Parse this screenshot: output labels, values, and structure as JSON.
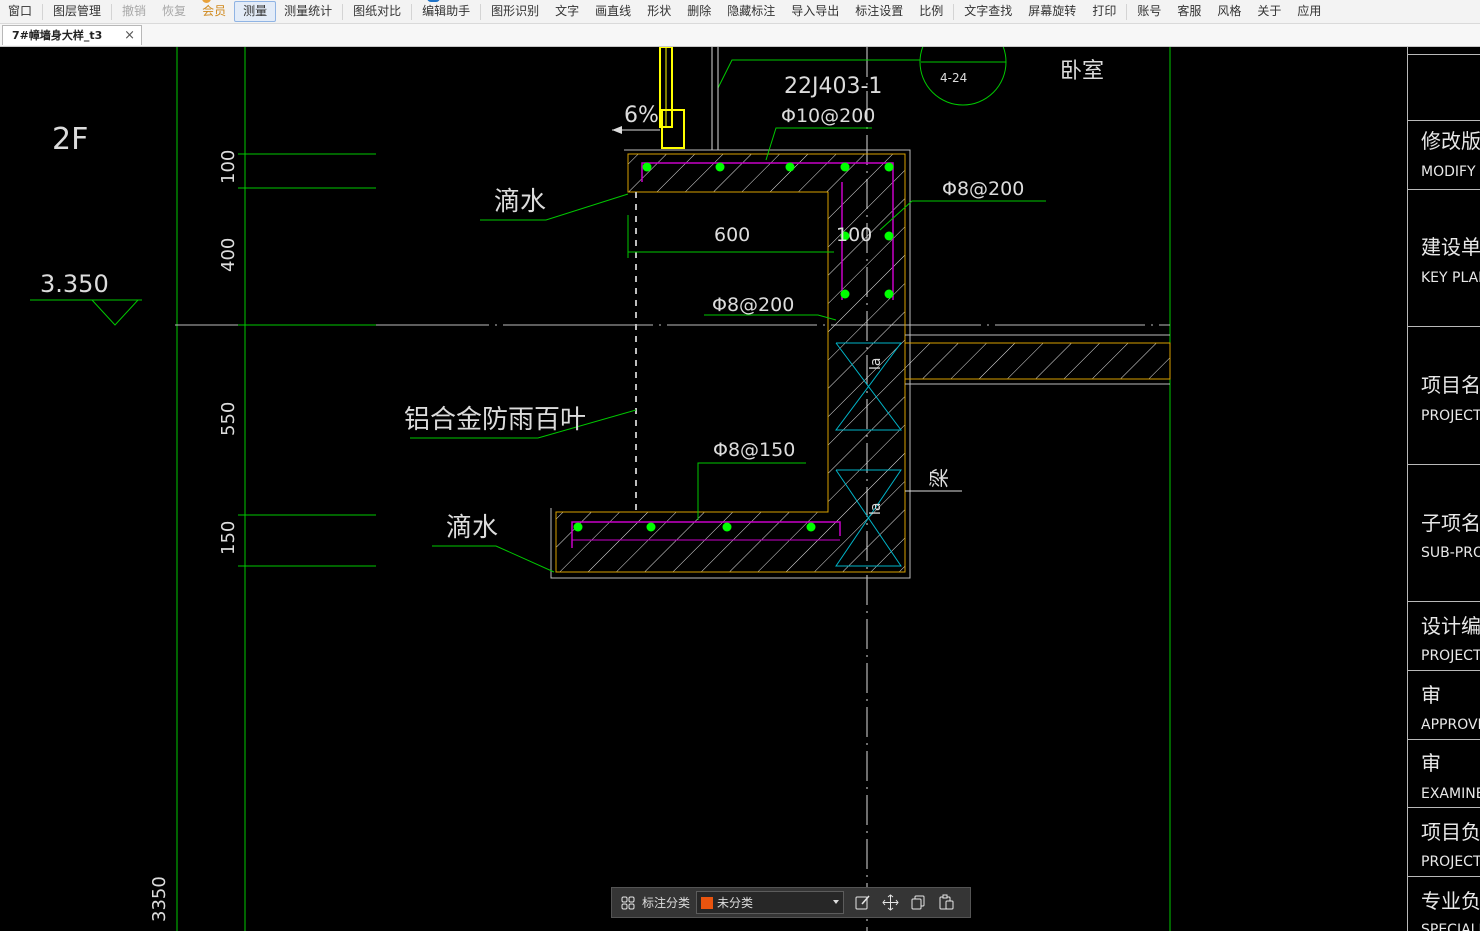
{
  "menu": {
    "items": [
      "窗口",
      "图层管理",
      "撤销",
      "恢复",
      "会员",
      "测量",
      "测量统计",
      "图纸对比",
      "编辑助手",
      "图形识别",
      "文字",
      "画直线",
      "形状",
      "删除",
      "隐藏标注",
      "导入导出",
      "标注设置",
      "比例",
      "文字查找",
      "屏幕旋转",
      "打印",
      "账号",
      "客服",
      "风格",
      "关于",
      "应用"
    ],
    "active": "测量",
    "disabled": [
      "撤销",
      "恢复"
    ]
  },
  "tab": {
    "title": "7#幛墙身大样_t3",
    "close": "×"
  },
  "drawing": {
    "floor": "2F",
    "elevation": "3.350",
    "dims": [
      "100",
      "400",
      "550",
      "150",
      "3350"
    ],
    "detail_ref": "22J403-1",
    "circle_ref": "4-24",
    "bedroom": "卧室",
    "slope": "6%",
    "rebars": [
      "Φ10@200",
      "Φ8@200",
      "Φ8@200",
      "Φ8@150"
    ],
    "width_dim": "600",
    "thick_dim": "100",
    "drip_top": "滴水",
    "drip_bottom": "滴水",
    "louver": "铝合金防雨百叶",
    "beam": "梁",
    "la": "la"
  },
  "title_block": [
    {
      "zh": "修改版次",
      "en": "MODIFY NO."
    },
    {
      "zh": "建设单位",
      "en": "KEY PLAN"
    },
    {
      "zh": "项目名称",
      "en": "PROJECT"
    },
    {
      "zh": "子项名称",
      "en": "SUB-PROJECT"
    },
    {
      "zh": "设计编号",
      "en": "PROJECT NO."
    },
    {
      "zh": "审",
      "en": "APPROVED"
    },
    {
      "zh": "审",
      "en": "EXAMINED"
    },
    {
      "zh": "项目负责",
      "en": "PROJECT"
    },
    {
      "zh": "专业负责",
      "en": "SPECIALITY"
    }
  ],
  "annotation_toolbar": {
    "label": "标注分类",
    "category": "未分类",
    "swatch_color": "#e8540f",
    "icons": [
      "grid-icon",
      "edit-icon",
      "move-icon",
      "copy-icon",
      "paste-icon"
    ]
  },
  "colors": {
    "green": "#00c800",
    "yellow": "#ffff00",
    "gold": "#d9a000",
    "magenta": "#c800c8",
    "cyan": "#00b4c8",
    "dot": "#00ff00",
    "line_white": "#e6e6e6"
  }
}
